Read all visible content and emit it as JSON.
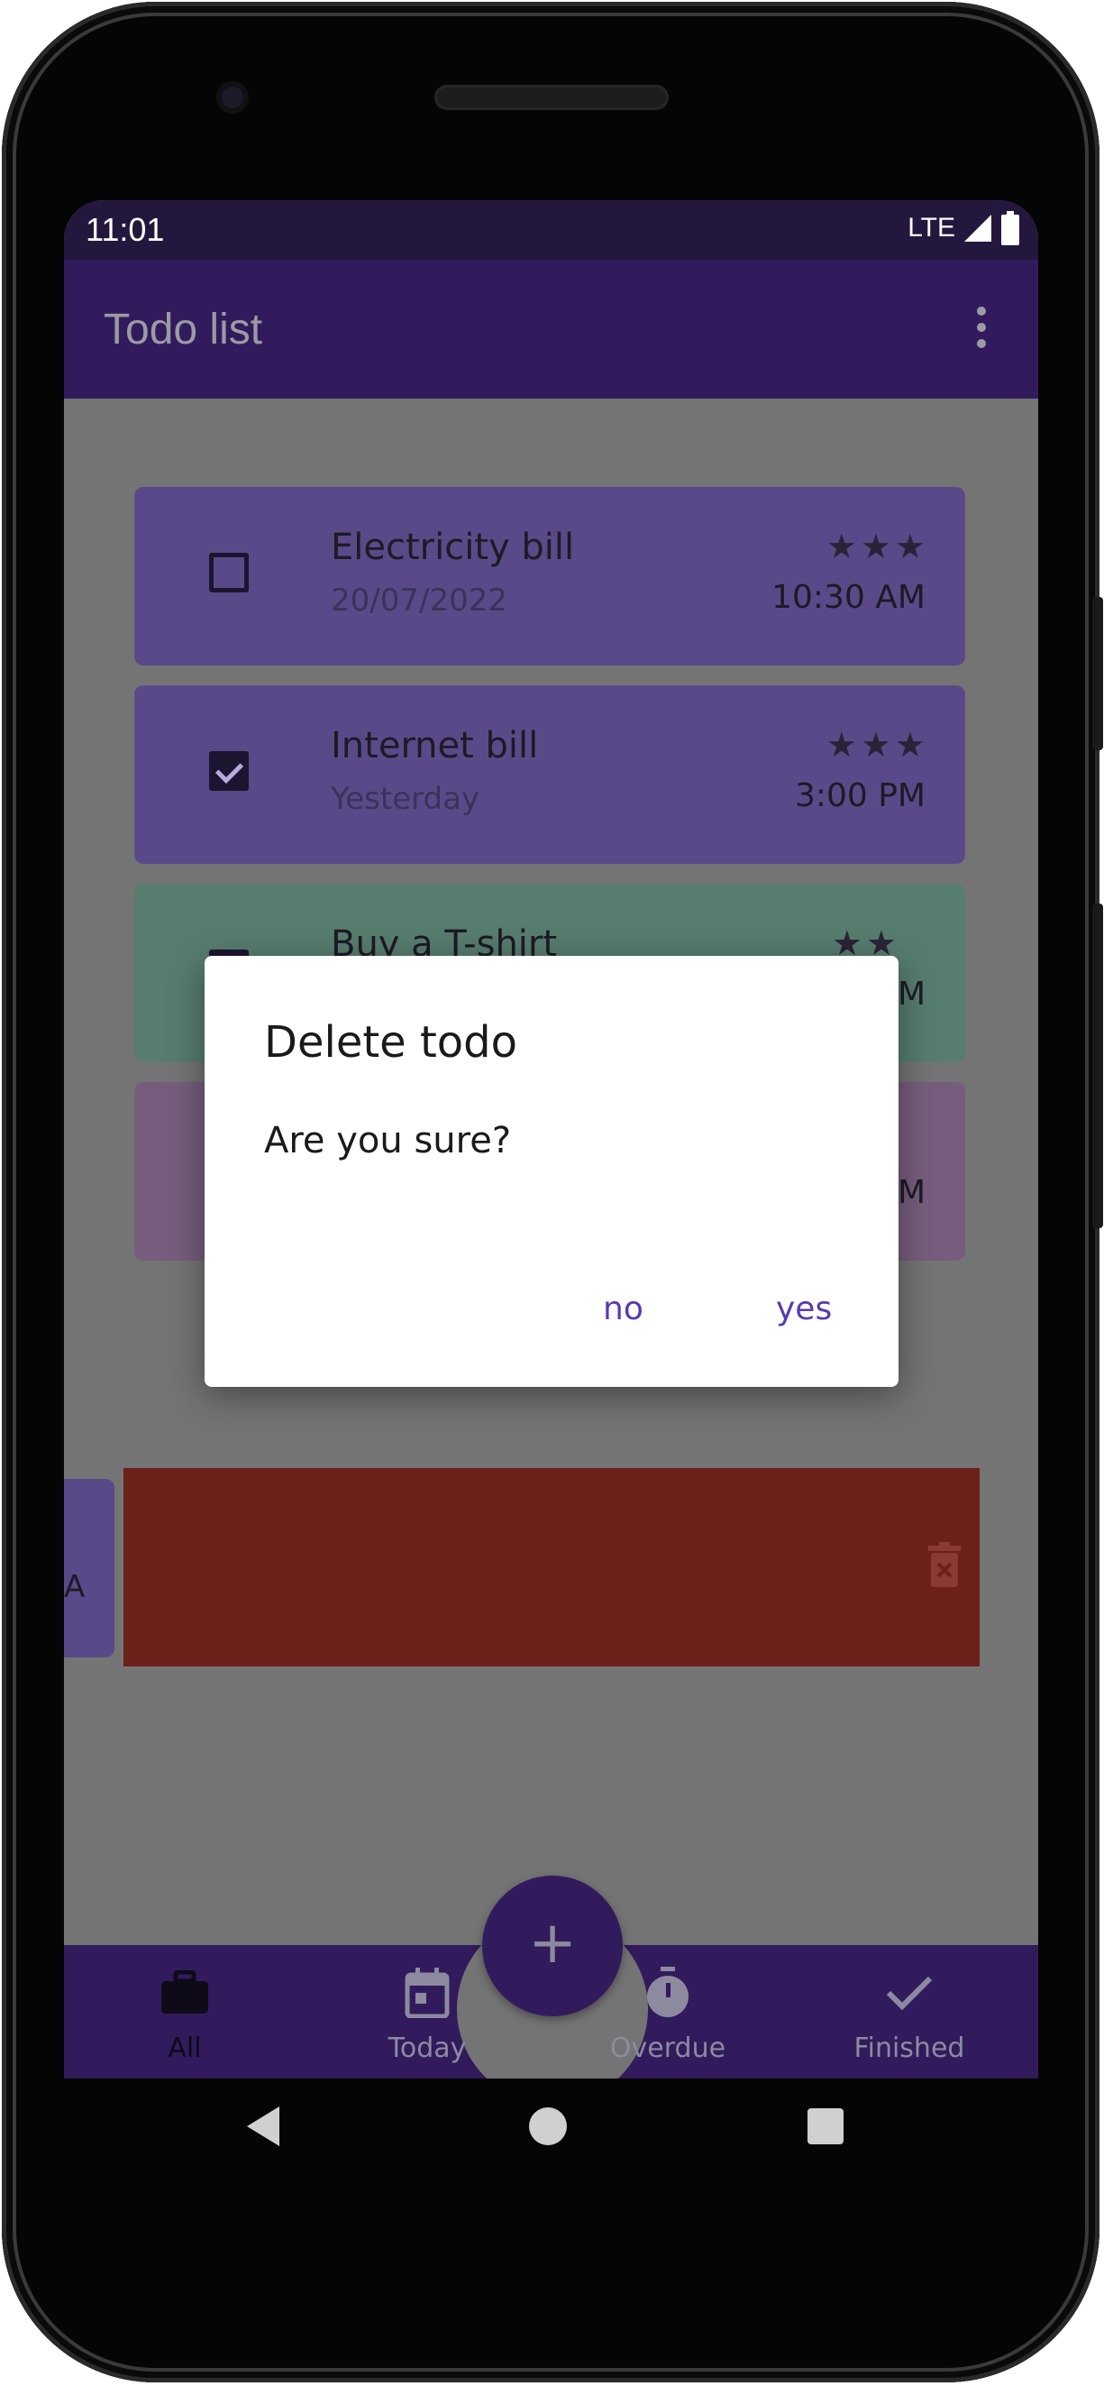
{
  "status_bar": {
    "time": "11:01",
    "network": "LTE"
  },
  "app_bar": {
    "title": "Todo list"
  },
  "todos": [
    {
      "title": "Electricity bill",
      "subtitle": "20/07/2022",
      "stars": "★★★",
      "time": "10:30 AM",
      "checked": false
    },
    {
      "title": "Internet bill",
      "subtitle": "Yesterday",
      "stars": "★★★",
      "time": "3:00 PM",
      "checked": true
    },
    {
      "title": "Buy a T-shirt",
      "stars": "★★",
      "time_partial": "M"
    },
    {
      "time_partial": "M"
    }
  ],
  "swiped_item": {
    "time_partial": "A"
  },
  "dialog": {
    "title": "Delete todo",
    "message": "Are you sure?",
    "no_label": "no",
    "yes_label": "yes"
  },
  "fab": {
    "label": "+"
  },
  "bottom_nav": [
    {
      "label": "All",
      "icon": "briefcase-icon",
      "active": true
    },
    {
      "label": "Today",
      "icon": "calendar-icon",
      "active": false
    },
    {
      "label": "Overdue",
      "icon": "timer-icon",
      "active": false
    },
    {
      "label": "Finished",
      "icon": "check-icon",
      "active": false
    }
  ],
  "colors": {
    "app_bar": "#311b5c",
    "card": "#5a4989",
    "delete_bg": "#6d1f1a",
    "dialog_button": "#5a3ab0"
  }
}
